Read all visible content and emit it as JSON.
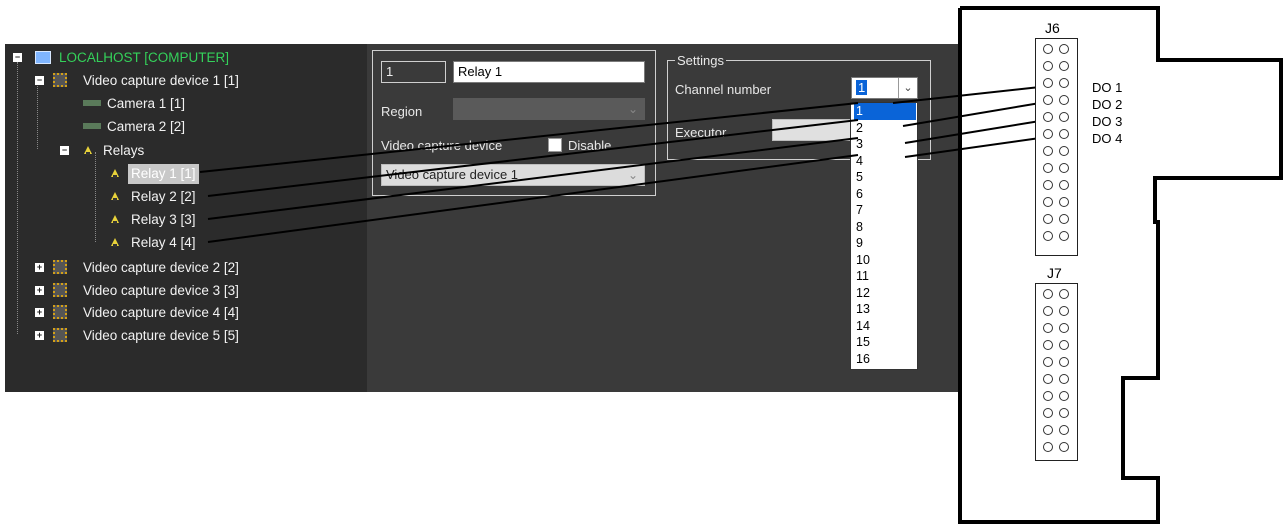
{
  "tree": {
    "root": "LOCALHOST [COMPUTER]",
    "device1": "Video capture device 1 [1]",
    "camera1": "Camera 1 [1]",
    "camera2": "Camera 2 [2]",
    "relays": "Relays",
    "relay1": "Relay 1 [1]",
    "relay2": "Relay 2 [2]",
    "relay3": "Relay 3 [3]",
    "relay4": "Relay 4 [4]",
    "device2": "Video capture device 2 [2]",
    "device3": "Video capture device 3 [3]",
    "device4": "Video capture device 4 [4]",
    "device5": "Video capture device 5 [5]",
    "expand_minus": "−",
    "expand_plus": "+"
  },
  "panel": {
    "id_value": "1",
    "name_value": "Relay 1",
    "region_label": "Region",
    "device_label": "Video capture device",
    "disable_label": "Disable",
    "device_value": "Video capture device 1",
    "settings_title": "Settings",
    "channel_label": "Channel number",
    "channel_value": "1",
    "executor_label": "Executor",
    "arrow": "⌄"
  },
  "dropdown": [
    "1",
    "2",
    "3",
    "4",
    "5",
    "6",
    "7",
    "8",
    "9",
    "10",
    "11",
    "12",
    "13",
    "14",
    "15",
    "16"
  ],
  "board": {
    "j6": "J6",
    "j7": "J7",
    "do1": "DO 1",
    "do2": "DO 2",
    "do3": "DO 3",
    "do4": "DO 4"
  },
  "colors": {
    "root_text": "#34d15a",
    "selection": "#0a64d8",
    "panel_bg": "#3a3a3a",
    "tree_bg": "#2b2b2b"
  }
}
